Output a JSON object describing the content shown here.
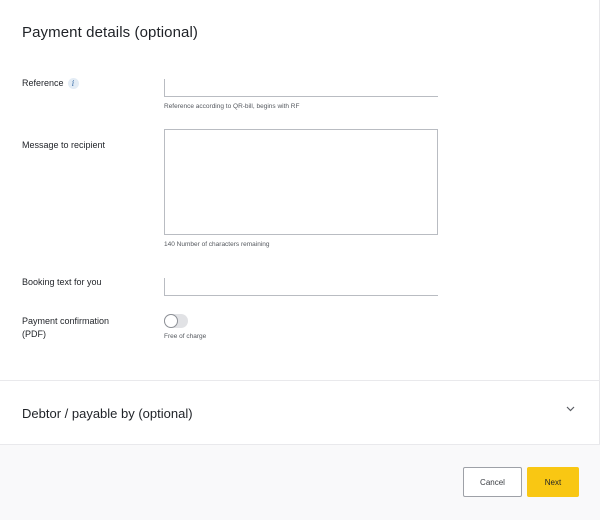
{
  "payment_details": {
    "title": "Payment details (optional)",
    "reference": {
      "label": "Reference",
      "info_icon": "i",
      "value": "",
      "hint": "Reference according to QR-bill, begins with RF"
    },
    "message": {
      "label": "Message to recipient",
      "value": "",
      "hint": "140 Number of characters remaining"
    },
    "booking_text": {
      "label": "Booking text for you",
      "value": ""
    },
    "payment_confirmation": {
      "label_line1": "Payment confirmation",
      "label_line2": "(PDF)",
      "enabled": false,
      "hint": "Free of charge"
    }
  },
  "debtor": {
    "title": "Debtor / payable by (optional)",
    "chevron_icon": "chevron-down-icon"
  },
  "footer": {
    "cancel_label": "Cancel",
    "next_label": "Next"
  },
  "colors": {
    "accent": "#f9c713",
    "border": "#b9bcc2",
    "text": "#1f2227"
  }
}
